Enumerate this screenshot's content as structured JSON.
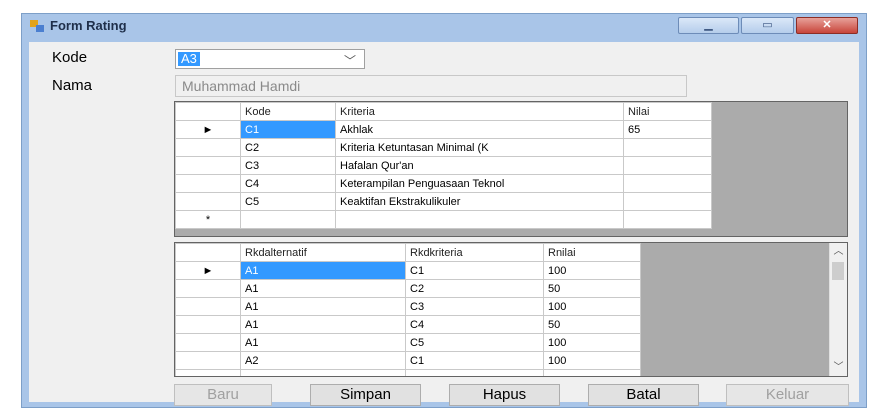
{
  "window": {
    "title": "Form Rating"
  },
  "form": {
    "kode_label": "Kode",
    "kode_value": "A3",
    "nama_label": "Nama",
    "nama_value": "Muhammad Hamdi"
  },
  "kriteria_grid": {
    "columns": [
      "Kode",
      "Kriteria",
      "Nilai"
    ],
    "rows": [
      {
        "kode": "C1",
        "kriteria": "Akhlak",
        "nilai": "65"
      },
      {
        "kode": "C2",
        "kriteria": "Kriteria Ketuntasan Minimal (K",
        "nilai": ""
      },
      {
        "kode": "C3",
        "kriteria": "Hafalan Qur'an",
        "nilai": ""
      },
      {
        "kode": "C4",
        "kriteria": "Keterampilan Penguasaan Teknol",
        "nilai": ""
      },
      {
        "kode": "C5",
        "kriteria": "Keaktifan Ekstrakulikuler",
        "nilai": ""
      }
    ],
    "new_row_marker": "*",
    "current_row_marker": "►"
  },
  "rating_grid": {
    "columns": [
      "Rkdalternatif",
      "Rkdkriteria",
      "Rnilai"
    ],
    "rows": [
      {
        "alt": "A1",
        "krit": "C1",
        "nilai": "100"
      },
      {
        "alt": "A1",
        "krit": "C2",
        "nilai": "50"
      },
      {
        "alt": "A1",
        "krit": "C3",
        "nilai": "100"
      },
      {
        "alt": "A1",
        "krit": "C4",
        "nilai": "50"
      },
      {
        "alt": "A1",
        "krit": "C5",
        "nilai": "100"
      },
      {
        "alt": "A2",
        "krit": "C1",
        "nilai": "100"
      }
    ],
    "current_row_marker": "►"
  },
  "buttons": {
    "baru": "Baru",
    "simpan": "Simpan",
    "hapus": "Hapus",
    "batal": "Batal",
    "keluar": "Keluar"
  },
  "icons": {
    "app": "form-app-icon",
    "minimize": "minimize-icon",
    "maximize": "maximize-icon",
    "close": "close-icon",
    "dropdown": "chevron-down-icon"
  },
  "colors": {
    "selection": "#3399ff",
    "title_bar": "#a9c5e8",
    "close_button": "#c8453a"
  }
}
